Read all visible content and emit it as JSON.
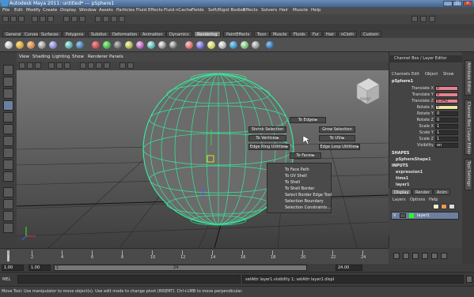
{
  "window": {
    "title": "Autodesk Maya 2011: untitled*   ---   pSphere1"
  },
  "menubar": [
    "File",
    "Edit",
    "Modify",
    "Create",
    "Display",
    "Window",
    "Assets",
    "Particles",
    "Fluid Effects",
    "Fluid nCache",
    "Fields",
    "Soft/Rigid Bodies",
    "Effects",
    "Solvers",
    "Hair",
    "Muscle",
    "Help"
  ],
  "shelf_tabs": [
    "General",
    "Curves",
    "Surfaces",
    "Polygons",
    "Subdivs",
    "Deformation",
    "Animation",
    "Dynamics",
    "Rendering",
    "PaintEffects",
    "Toon",
    "Muscle",
    "Fluids",
    "Fur",
    "Hair",
    "nCloth",
    "Custom"
  ],
  "shelf_active": "Rendering",
  "viewport_menu": [
    "View",
    "Shading",
    "Lighting",
    "Show",
    "Renderer",
    "Panels"
  ],
  "viewcube_label": "FRONT",
  "marking_menu": {
    "north": "To Edges",
    "nw": "Shrink Selection",
    "ne": "Grow Selection",
    "west": "To Vertices",
    "east": "To UVs",
    "sw": "Edge Ring Utilities",
    "se": "Edge Loop Utilities",
    "south": "To Faces"
  },
  "dropdown": [
    "To Face Path",
    "To UV Shell",
    "To Shell",
    "To Shell Border",
    "Select Border Edge Tool",
    "Selection Boundary",
    "Selection Constraints..."
  ],
  "channel_box": {
    "title": "Channel Box / Layer Editor",
    "menu": [
      "Channels",
      "Edit",
      "Object",
      "Show"
    ],
    "object": "pSphere1",
    "attributes": [
      {
        "label": "Translate X",
        "value": "0"
      },
      {
        "label": "Translate Y",
        "value": "0"
      },
      {
        "label": "Translate Z",
        "value": "0.042"
      },
      {
        "label": "Rotate X",
        "value": "0"
      },
      {
        "label": "Rotate Y",
        "value": "0"
      },
      {
        "label": "Rotate Z",
        "value": "0"
      },
      {
        "label": "Scale X",
        "value": "1"
      },
      {
        "label": "Scale Y",
        "value": "1"
      },
      {
        "label": "Scale Z",
        "value": "1"
      },
      {
        "label": "Visibility",
        "value": "on"
      }
    ],
    "shapes_header": "SHAPES",
    "shape": "pSphereShape1",
    "inputs_header": "INPUTS",
    "inputs": [
      "expression1",
      "time1",
      "layer1"
    ]
  },
  "layer_editor": {
    "tabs": [
      "Display",
      "Render",
      "Anim"
    ],
    "menu": [
      "Layers",
      "Options",
      "Help"
    ],
    "layer_vis": "V",
    "layer_name": "layer1"
  },
  "side_tabs": [
    "Attribute Editor",
    "Channel Box / Layer Editor",
    "Tool Settings"
  ],
  "timeline_ticks": [
    "1",
    "2",
    "4",
    "6",
    "8",
    "10",
    "12",
    "14",
    "16",
    "18",
    "20",
    "22",
    "24"
  ],
  "range": {
    "start": "1.00",
    "current": "1.00",
    "playback_start": "1",
    "playback_end": "24",
    "end": "24.00"
  },
  "cmdline": {
    "label": "MEL",
    "output": "setAttr layer1.visibility 1; setAttr layer1.displ"
  },
  "helpline": "Move Tool: Use manipulator to move object(s). Use edit mode to change pivot (INSERT). Ctrl+LMB to move perpendicular."
}
